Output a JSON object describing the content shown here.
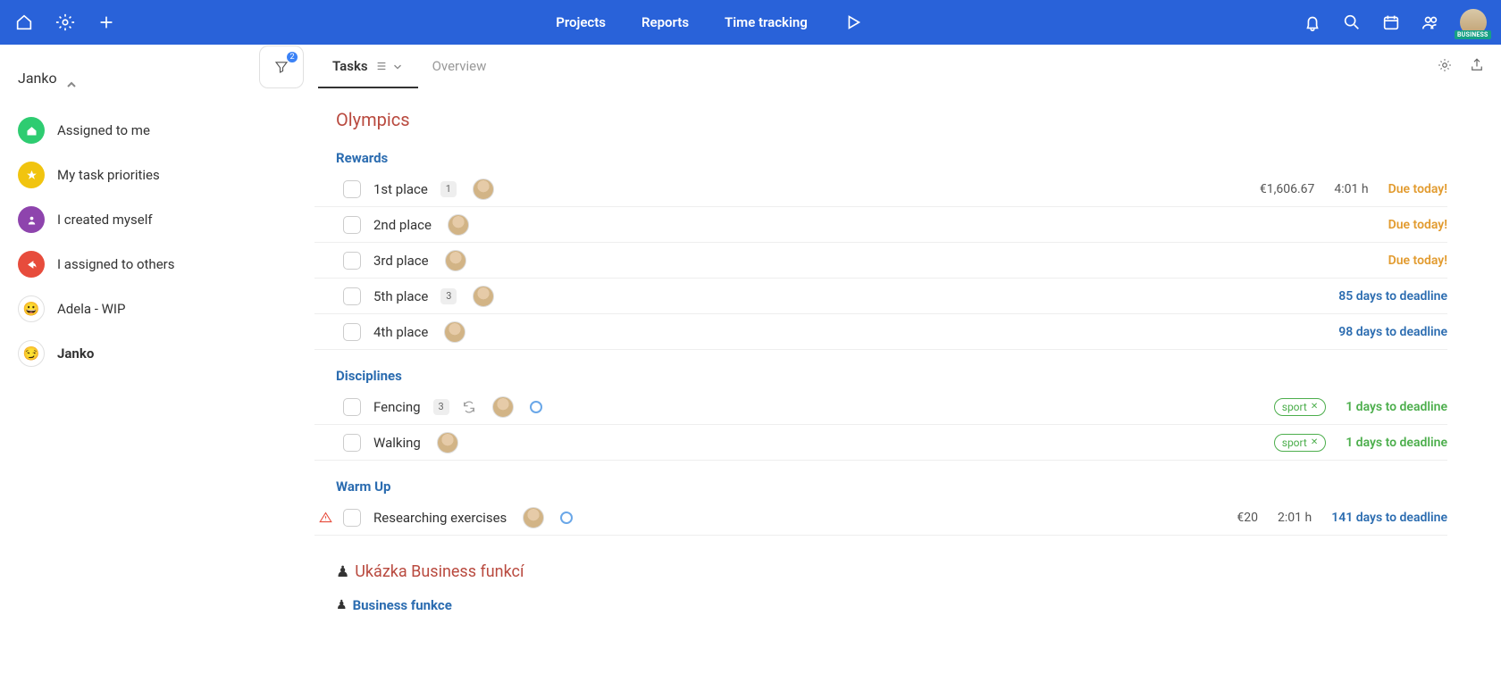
{
  "header": {
    "nav": {
      "projects": "Projects",
      "reports": "Reports",
      "time_tracking": "Time tracking"
    },
    "avatar_badge": "BUSINESS"
  },
  "sidebar": {
    "user": "Janko",
    "items": [
      {
        "label": "Assigned to me",
        "color": "#2ecc71",
        "icon": "home"
      },
      {
        "label": "My task priorities",
        "color": "#f1c40f",
        "icon": "star"
      },
      {
        "label": "I created myself",
        "color": "#8e44ad",
        "icon": "person"
      },
      {
        "label": "I assigned to others",
        "color": "#e74c3c",
        "icon": "share"
      },
      {
        "label": "Adela - WIP",
        "color": "#fff",
        "icon": "emoji",
        "emoji": "😀"
      },
      {
        "label": "Janko",
        "color": "#fff",
        "icon": "emoji",
        "emoji": "😏",
        "active": true
      }
    ]
  },
  "tabs": {
    "filter_count": "2",
    "tasks": "Tasks",
    "overview": "Overview"
  },
  "content": {
    "project": "Olympics",
    "sections": [
      {
        "title": "Rewards",
        "tasks": [
          {
            "name": "1st place",
            "count": "1",
            "avatar": true,
            "price": "€1,606.67",
            "hours": "4:01 h",
            "deadline": "Due today!",
            "dclass": "orange"
          },
          {
            "name": "2nd place",
            "avatar": true,
            "deadline": "Due today!",
            "dclass": "orange"
          },
          {
            "name": "3rd place",
            "avatar": true,
            "deadline": "Due today!",
            "dclass": "orange"
          },
          {
            "name": "5th place",
            "count": "3",
            "avatar": true,
            "deadline": "85 days to deadline",
            "dclass": "blue"
          },
          {
            "name": "4th place",
            "avatar": true,
            "deadline": "98 days to deadline",
            "dclass": "blue"
          }
        ]
      },
      {
        "title": "Disciplines",
        "tasks": [
          {
            "name": "Fencing",
            "count": "3",
            "repeat": true,
            "avatar": true,
            "ring": true,
            "tag": "sport",
            "deadline": "1 days to deadline",
            "dclass": "green"
          },
          {
            "name": "Walking",
            "avatar": true,
            "tag": "sport",
            "deadline": "1 days to deadline",
            "dclass": "green"
          }
        ]
      },
      {
        "title": "Warm Up",
        "tasks": [
          {
            "name": "Researching exercises",
            "warning": true,
            "avatar": true,
            "ring": true,
            "price": "€20",
            "hours": "2:01 h",
            "deadline": "141 days to deadline",
            "dclass": "blue"
          }
        ]
      }
    ],
    "footer_project_title": "Ukázka Business funkcí",
    "footer_section_title": "Business funkce"
  }
}
